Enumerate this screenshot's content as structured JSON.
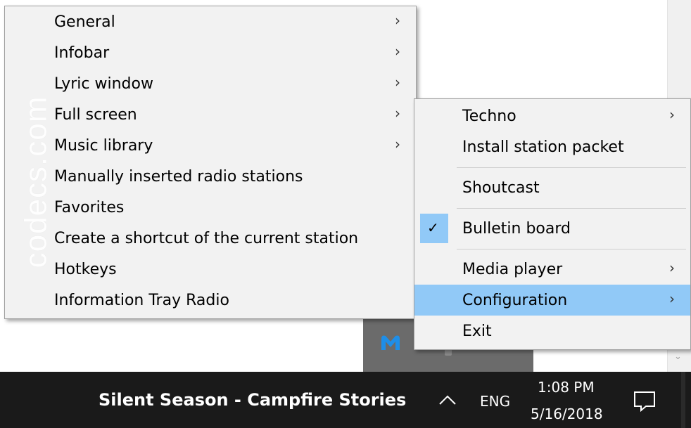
{
  "main_menu": {
    "items": [
      {
        "label": "General",
        "has_submenu": true
      },
      {
        "label": "Infobar",
        "has_submenu": true
      },
      {
        "label": "Lyric window",
        "has_submenu": true
      },
      {
        "label": "Full screen",
        "has_submenu": true
      },
      {
        "label": "Music library",
        "has_submenu": true
      },
      {
        "label": "Manually inserted radio stations",
        "has_submenu": false
      },
      {
        "label": "Favorites",
        "has_submenu": false
      },
      {
        "label": "Create a shortcut of the current station",
        "has_submenu": false
      },
      {
        "label": "Hotkeys",
        "has_submenu": false
      },
      {
        "label": "Information Tray Radio",
        "has_submenu": false
      }
    ]
  },
  "tray_menu": {
    "items": [
      {
        "label": "Techno",
        "has_submenu": true
      },
      {
        "label": "Install station packet",
        "has_submenu": false
      },
      {
        "label": "Shoutcast",
        "has_submenu": false
      },
      {
        "label": "Bulletin board",
        "checked": true
      },
      {
        "label": "Media player",
        "has_submenu": true
      },
      {
        "label": "Configuration",
        "has_submenu": true,
        "highlighted": true
      },
      {
        "label": "Exit",
        "has_submenu": false
      }
    ]
  },
  "watermark": {
    "text": "codecs.com"
  },
  "taskbar": {
    "now_playing": "Silent Season - Campfire Stories",
    "language": "ENG",
    "time": "1:08 PM",
    "date": "5/16/2018"
  },
  "colors": {
    "menu_bg": "#f2f2f2",
    "highlight": "#91c9f7",
    "taskbar_bg": "#1a1a1a"
  },
  "icons": {
    "submenu_arrow": "chevron-right-icon",
    "check": "checkmark-icon",
    "tray_expand": "chevron-up-icon",
    "notifications": "action-center-icon",
    "tray_app": "malwarebytes-icon"
  }
}
